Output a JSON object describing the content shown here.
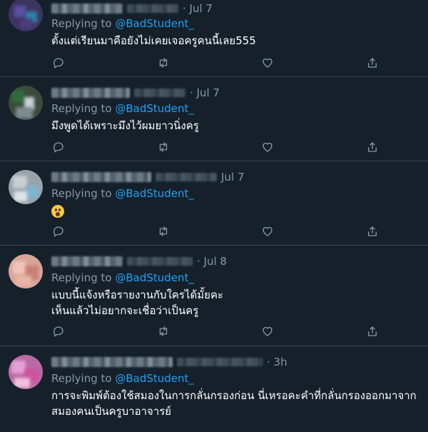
{
  "colors": {
    "background": "#15202b",
    "divider": "#38444d",
    "muted": "#8899a6",
    "accent": "#1da1f2",
    "text": "#ffffff"
  },
  "actions_icons": [
    "reply-icon",
    "retweet-icon",
    "like-icon",
    "share-icon"
  ],
  "replying_prefix": "Replying to",
  "tweets": [
    {
      "date": "· Jul 7",
      "mention": "@BadStudent_",
      "text": [
        "ตั้งแต่เรียนมาคือยังไม่เคยเจอครูคนนี้เลย555"
      ]
    },
    {
      "date": "· Jul 7",
      "mention": "@BadStudent_",
      "text": [
        "มึงพูดได้เพราะมึงไว้ผมยาวนิ่งครู"
      ]
    },
    {
      "date": "Jul 7",
      "mention": "@BadStudent_",
      "emoji": "astonished-face-emoji"
    },
    {
      "date": "· Jul 8",
      "mention": "@BadStudent_",
      "text": [
        "แบบนี้แจ้งหรือรายงานกับใครได้มั้ยคะ",
        "เห็นแล้วไม่อยากจะเชื่อว่าเป็นครู"
      ]
    },
    {
      "date": "· 3h",
      "mention": "@BadStudent_",
      "text": [
        "การจะพิมพ์ต้องใช้สมองในการกลั่นกรองก่อน นี่เหรอคะคำที่กลั่นกรองออกมาจาก",
        "สมองคนเป็นครูบาอาจารย์"
      ]
    }
  ]
}
